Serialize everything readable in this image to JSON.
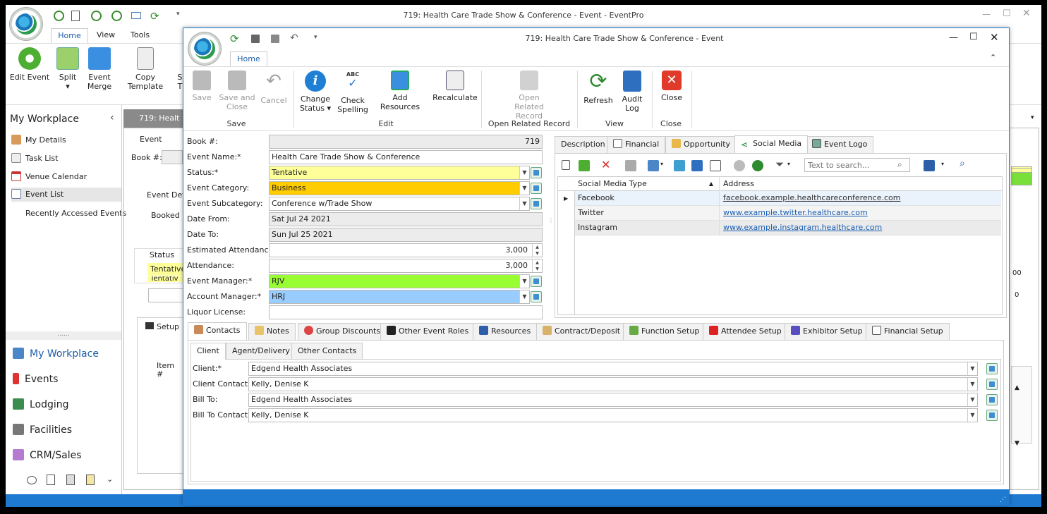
{
  "main_window": {
    "title": "719: Health Care Trade Show & Conference - Event - EventPro",
    "tabs": [
      "Home",
      "View",
      "Tools"
    ],
    "ribbon": [
      "Edit Event",
      "Split",
      "Event Merge",
      "Copy Template",
      "S T"
    ],
    "workplace_title": "My Workplace",
    "nav_items": [
      "My Details",
      "Task List",
      "Venue Calendar",
      "Event List",
      "Recently Accessed Events"
    ],
    "big_nav": [
      "My Workplace",
      "Events",
      "Lodging",
      "Facilities",
      "CRM/Sales"
    ],
    "bg_tab": "719: Healt",
    "bg_labels": {
      "event": "Event",
      "book": "Book #:",
      "event_det": "Event Det",
      "booked": "Booked Lo",
      "status": "Status",
      "tentative": "Tentative",
      "tentative2": "Tentativ",
      "setup": "Setup",
      "item": "Item #",
      "v1": "00",
      "v2": "0"
    }
  },
  "dialog": {
    "title": "719: Health Care Trade Show & Conference - Event",
    "tab": "Home",
    "ribbon": {
      "save": "Save",
      "save_close": "Save and Close",
      "cancel": "Cancel",
      "change_status": "Change Status",
      "check_spelling": "Check Spelling",
      "spell_abc": "ABC",
      "add_resources": "Add Resources",
      "recalculate": "Recalculate",
      "open_related": "Open Related Record",
      "refresh": "Refresh",
      "audit_log": "Audit Log",
      "close": "Close",
      "groups": {
        "save": "Save",
        "edit": "Edit",
        "open": "Open Related Record",
        "view": "View",
        "close": "Close"
      }
    },
    "form": {
      "labels": [
        "Book #:",
        "Event Name:*",
        "Status:*",
        "Event Category:",
        "Event Subcategory:",
        "Date From:",
        "Date To:",
        "Estimated Attendance:",
        "Attendance:",
        "Event Manager:*",
        "Account Manager:*",
        "Liquor License:"
      ],
      "book": "719",
      "event_name": "Health Care Trade Show & Conference",
      "status": "Tentative",
      "category": "Business",
      "subcategory": "Conference w/Trade Show",
      "date_from": "Sat Jul 24 2021",
      "date_to": "Sun Jul 25 2021",
      "est_attendance": "3,000",
      "attendance": "3,000",
      "event_manager": "RJV",
      "account_manager": "HRJ",
      "liquor": ""
    },
    "right_tabs": [
      "Description",
      "Financial",
      "Opportunity",
      "Social Media",
      "Event Logo"
    ],
    "search_placeholder": "Text to search...",
    "grid": {
      "headers": [
        "Social Media Type",
        "Address"
      ],
      "rows": [
        {
          "type": "Facebook",
          "address": "facebook.example.healthcareconference.com"
        },
        {
          "type": "Twitter",
          "address": "www.example.twitter.healthcare.com"
        },
        {
          "type": "Instagram",
          "address": "www.example.instagram.healthcare.com"
        }
      ]
    },
    "bottom_tabs": [
      "Contacts",
      "Notes",
      "Group Discounts",
      "Other Event Roles",
      "Resources",
      "Contract/Deposit",
      "Function Setup",
      "Attendee Setup",
      "Exhibitor Setup",
      "Financial Setup"
    ],
    "sub_tabs": [
      "Client",
      "Agent/Delivery",
      "Other Contacts"
    ],
    "contacts": {
      "labels": [
        "Client:*",
        "Client Contact:",
        "Bill To:",
        "Bill To Contact:"
      ],
      "client": "Edgend Health Associates",
      "client_contact": "Kelly, Denise K",
      "bill_to": "Edgend Health Associates",
      "bill_to_contact": "Kelly, Denise K"
    }
  },
  "colors": {
    "accent": "#1e7ad1",
    "status_yellow": "#ffff99",
    "category_orange": "#ffcc00",
    "manager_green": "#99ff33",
    "account_blue": "#99ccff"
  }
}
